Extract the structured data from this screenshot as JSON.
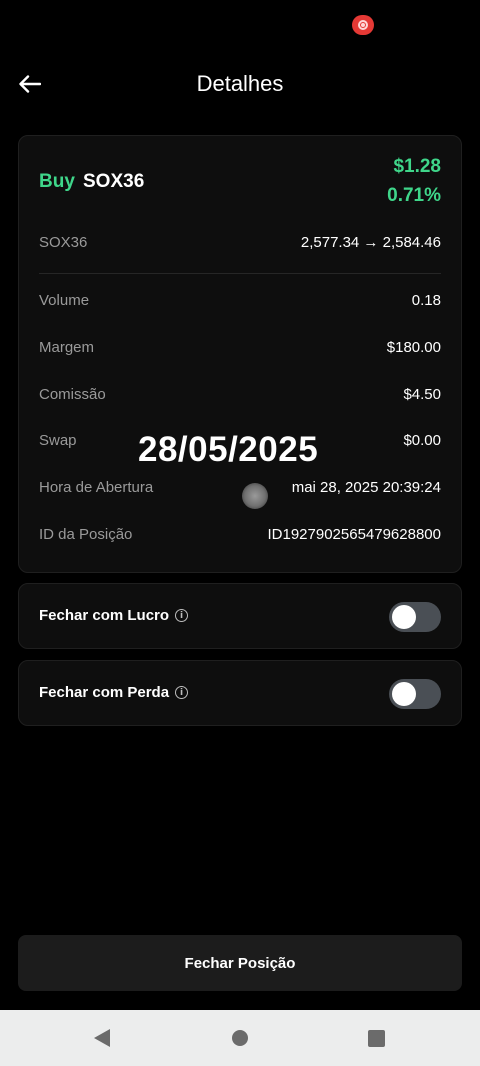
{
  "header": {
    "title": "Detalhes",
    "back_icon": "arrow-left-icon"
  },
  "position": {
    "side": "Buy",
    "symbol": "SOX36",
    "pnl_value": "$1.28",
    "pnl_percent": "0.71%",
    "pnl_color": "#3fd68a",
    "price_label": "SOX36",
    "price_change": "2,577.34 → 2,584.46",
    "details": [
      {
        "label": "Volume",
        "value": "0.18"
      },
      {
        "label": "Margem",
        "value": "$180.00"
      },
      {
        "label": "Comissão",
        "value": "$4.50"
      },
      {
        "label": "Swap",
        "value": "$0.00"
      },
      {
        "label": "Hora de Abertura",
        "value": "mai 28, 2025 20:39:24"
      },
      {
        "label": "ID da Posição",
        "value": "ID1927902565479628800"
      }
    ]
  },
  "overlay": {
    "date": "28/05/2025"
  },
  "toggles": {
    "take_profit": {
      "label": "Fechar com Lucro",
      "enabled": false
    },
    "stop_loss": {
      "label": "Fechar com Perda",
      "enabled": false
    }
  },
  "actions": {
    "close_position": "Fechar Posição"
  },
  "system_nav": {
    "back": "back-triangle-icon",
    "home": "home-circle-icon",
    "recents": "recents-square-icon"
  }
}
